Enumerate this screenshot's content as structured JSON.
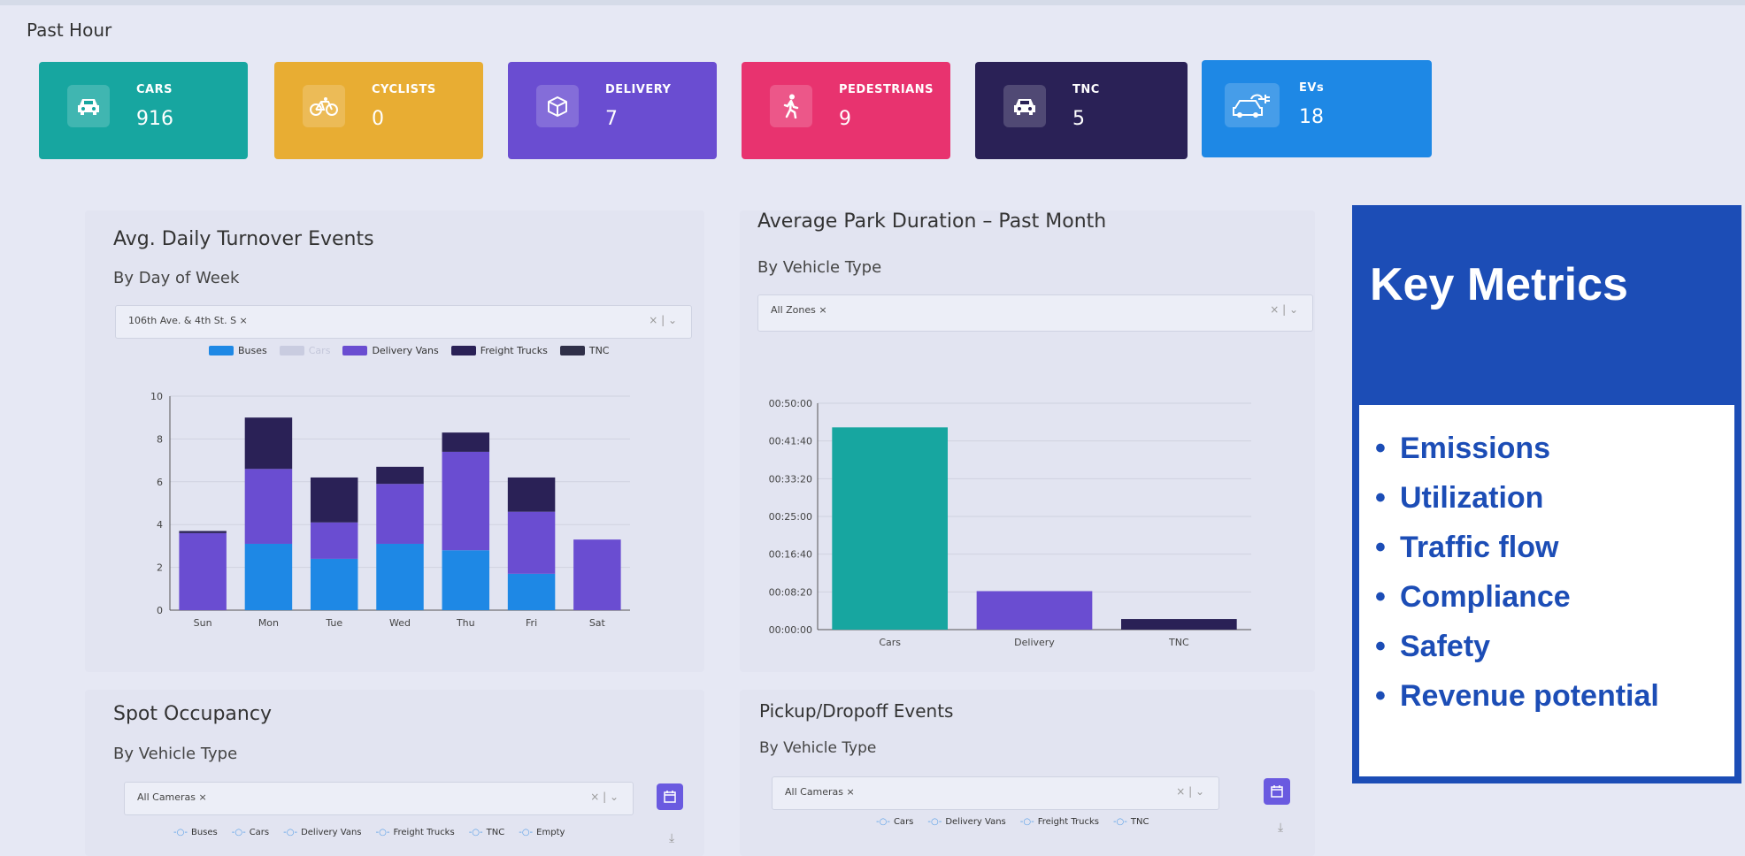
{
  "section_title": "Past Hour",
  "cards": [
    {
      "label": "CARS",
      "value": "916",
      "color": "#17a6a0",
      "icon": "car-icon"
    },
    {
      "label": "CYCLISTS",
      "value": "0",
      "color": "#e8ad33",
      "icon": "bicycle-icon"
    },
    {
      "label": "DELIVERY",
      "value": "7",
      "color": "#6a4dd1",
      "icon": "box-icon"
    },
    {
      "label": "PEDESTRIANS",
      "value": "9",
      "color": "#e8336f",
      "icon": "walking-person-icon"
    },
    {
      "label": "TNC",
      "value": "5",
      "color": "#2a2156",
      "icon": "car-icon"
    },
    {
      "label": "EVs",
      "value": "18",
      "color": "#1e88e5",
      "icon": "ev-charging-car-icon"
    }
  ],
  "turnover": {
    "title": "Avg. Daily Turnover Events",
    "subtitle": "By Day of Week",
    "filter_chip": "106th Ave. & 4th St. S  ×",
    "filter_ctrls": "×  |  ⌄"
  },
  "park_duration": {
    "title": "Average Park Duration – Past Month",
    "subtitle": "By Vehicle Type",
    "filter_chip": "All Zones  ×",
    "filter_ctrls": "×  |  ⌄"
  },
  "spot_occupancy": {
    "title": "Spot Occupancy",
    "subtitle": "By Vehicle Type",
    "filter_chip": "All Cameras  ×",
    "filter_ctrls": "×  |  ⌄",
    "legend": [
      "Buses",
      "Cars",
      "Delivery Vans",
      "Freight Trucks",
      "TNC",
      "Empty"
    ]
  },
  "pickup_dropoff": {
    "title": "Pickup/Dropoff Events",
    "subtitle": "By Vehicle Type",
    "filter_chip": "All Cameras  ×",
    "filter_ctrls": "×  |  ⌄",
    "legend": [
      "Cars",
      "Delivery Vans",
      "Freight Trucks",
      "TNC"
    ]
  },
  "key_metrics": {
    "title": "Key Metrics",
    "items": [
      "Emissions",
      "Utilization",
      "Traffic flow",
      "Compliance",
      "Safety",
      "Revenue potential"
    ]
  },
  "chart_data": [
    {
      "type": "bar",
      "stacked": true,
      "categories": [
        "Sun",
        "Mon",
        "Tue",
        "Wed",
        "Thu",
        "Fri",
        "Sat"
      ],
      "ylim": [
        0,
        10
      ],
      "yticks": [
        0,
        2,
        4,
        6,
        8,
        10
      ],
      "legend_position": "top",
      "series": [
        {
          "name": "Buses",
          "color": "#1e88e5",
          "values": [
            0,
            3.1,
            2.4,
            3.1,
            2.8,
            1.7,
            0
          ]
        },
        {
          "name": "Cars",
          "color": "#c9cce0",
          "values": [
            0,
            0,
            0,
            0,
            0,
            0,
            0
          ]
        },
        {
          "name": "Delivery Vans",
          "color": "#6a4dd1",
          "values": [
            3.6,
            3.5,
            1.7,
            2.8,
            4.6,
            2.9,
            3.3
          ]
        },
        {
          "name": "Freight Trucks",
          "color": "#2a2156",
          "values": [
            0.1,
            2.4,
            2.1,
            0.8,
            0.9,
            1.6,
            0
          ]
        },
        {
          "name": "TNC",
          "color": "#2f2f48",
          "values": [
            0,
            0,
            0,
            0,
            0,
            0,
            0
          ]
        }
      ]
    },
    {
      "type": "bar",
      "categories": [
        "Cars",
        "Delivery",
        "TNC"
      ],
      "values": [
        2680,
        510,
        140
      ],
      "colors": [
        "#17a6a0",
        "#6a4dd1",
        "#2a2156"
      ],
      "value_unit": "seconds",
      "ylim": [
        0,
        3000
      ],
      "ytick_labels": [
        "00:00:00",
        "00:08:20",
        "00:16:40",
        "00:25:00",
        "00:33:20",
        "00:41:40",
        "00:50:00"
      ]
    }
  ]
}
